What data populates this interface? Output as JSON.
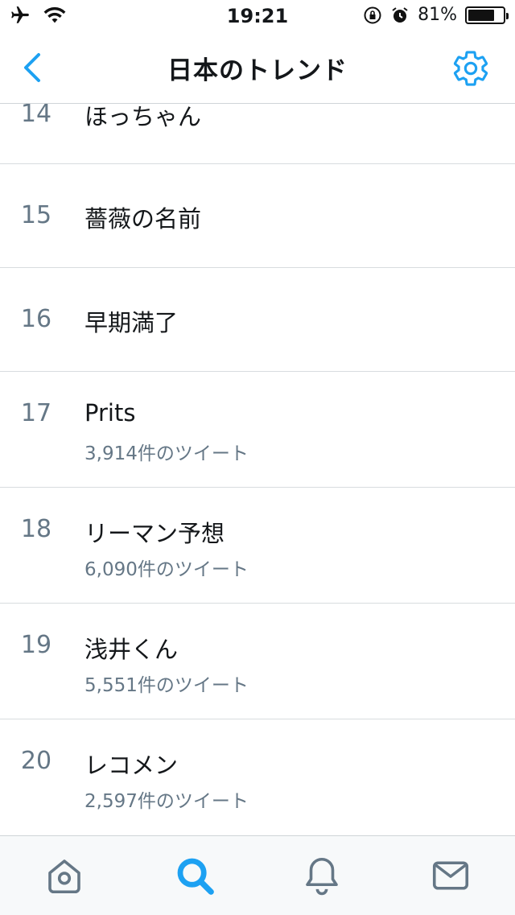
{
  "status_bar": {
    "time": "19:21",
    "battery_percent": "81%",
    "battery_level": 0.81,
    "icons": [
      "airplane-icon",
      "wifi-icon",
      "rotation-lock-icon",
      "alarm-icon",
      "battery-icon"
    ]
  },
  "nav": {
    "title": "日本のトレンド",
    "back_icon": "chevron-left-icon",
    "settings_icon": "gear-icon"
  },
  "trends": [
    {
      "rank": "14",
      "name": "ほっちゃん",
      "count": ""
    },
    {
      "rank": "15",
      "name": "薔薇の名前",
      "count": ""
    },
    {
      "rank": "16",
      "name": "早期満了",
      "count": ""
    },
    {
      "rank": "17",
      "name": "Prits",
      "count": "3,914件のツイート"
    },
    {
      "rank": "18",
      "name": "リーマン予想",
      "count": "6,090件のツイート"
    },
    {
      "rank": "19",
      "name": "浅井くん",
      "count": "5,551件のツイート"
    },
    {
      "rank": "20",
      "name": "レコメン",
      "count": "2,597件のツイート"
    }
  ],
  "tab_bar": {
    "tabs": [
      "home-icon",
      "search-icon",
      "notifications-icon",
      "messages-icon"
    ],
    "active": "search-icon"
  },
  "colors": {
    "accent": "#1da1f2",
    "icon_gray": "#657786",
    "divider": "#d8dcdf"
  }
}
